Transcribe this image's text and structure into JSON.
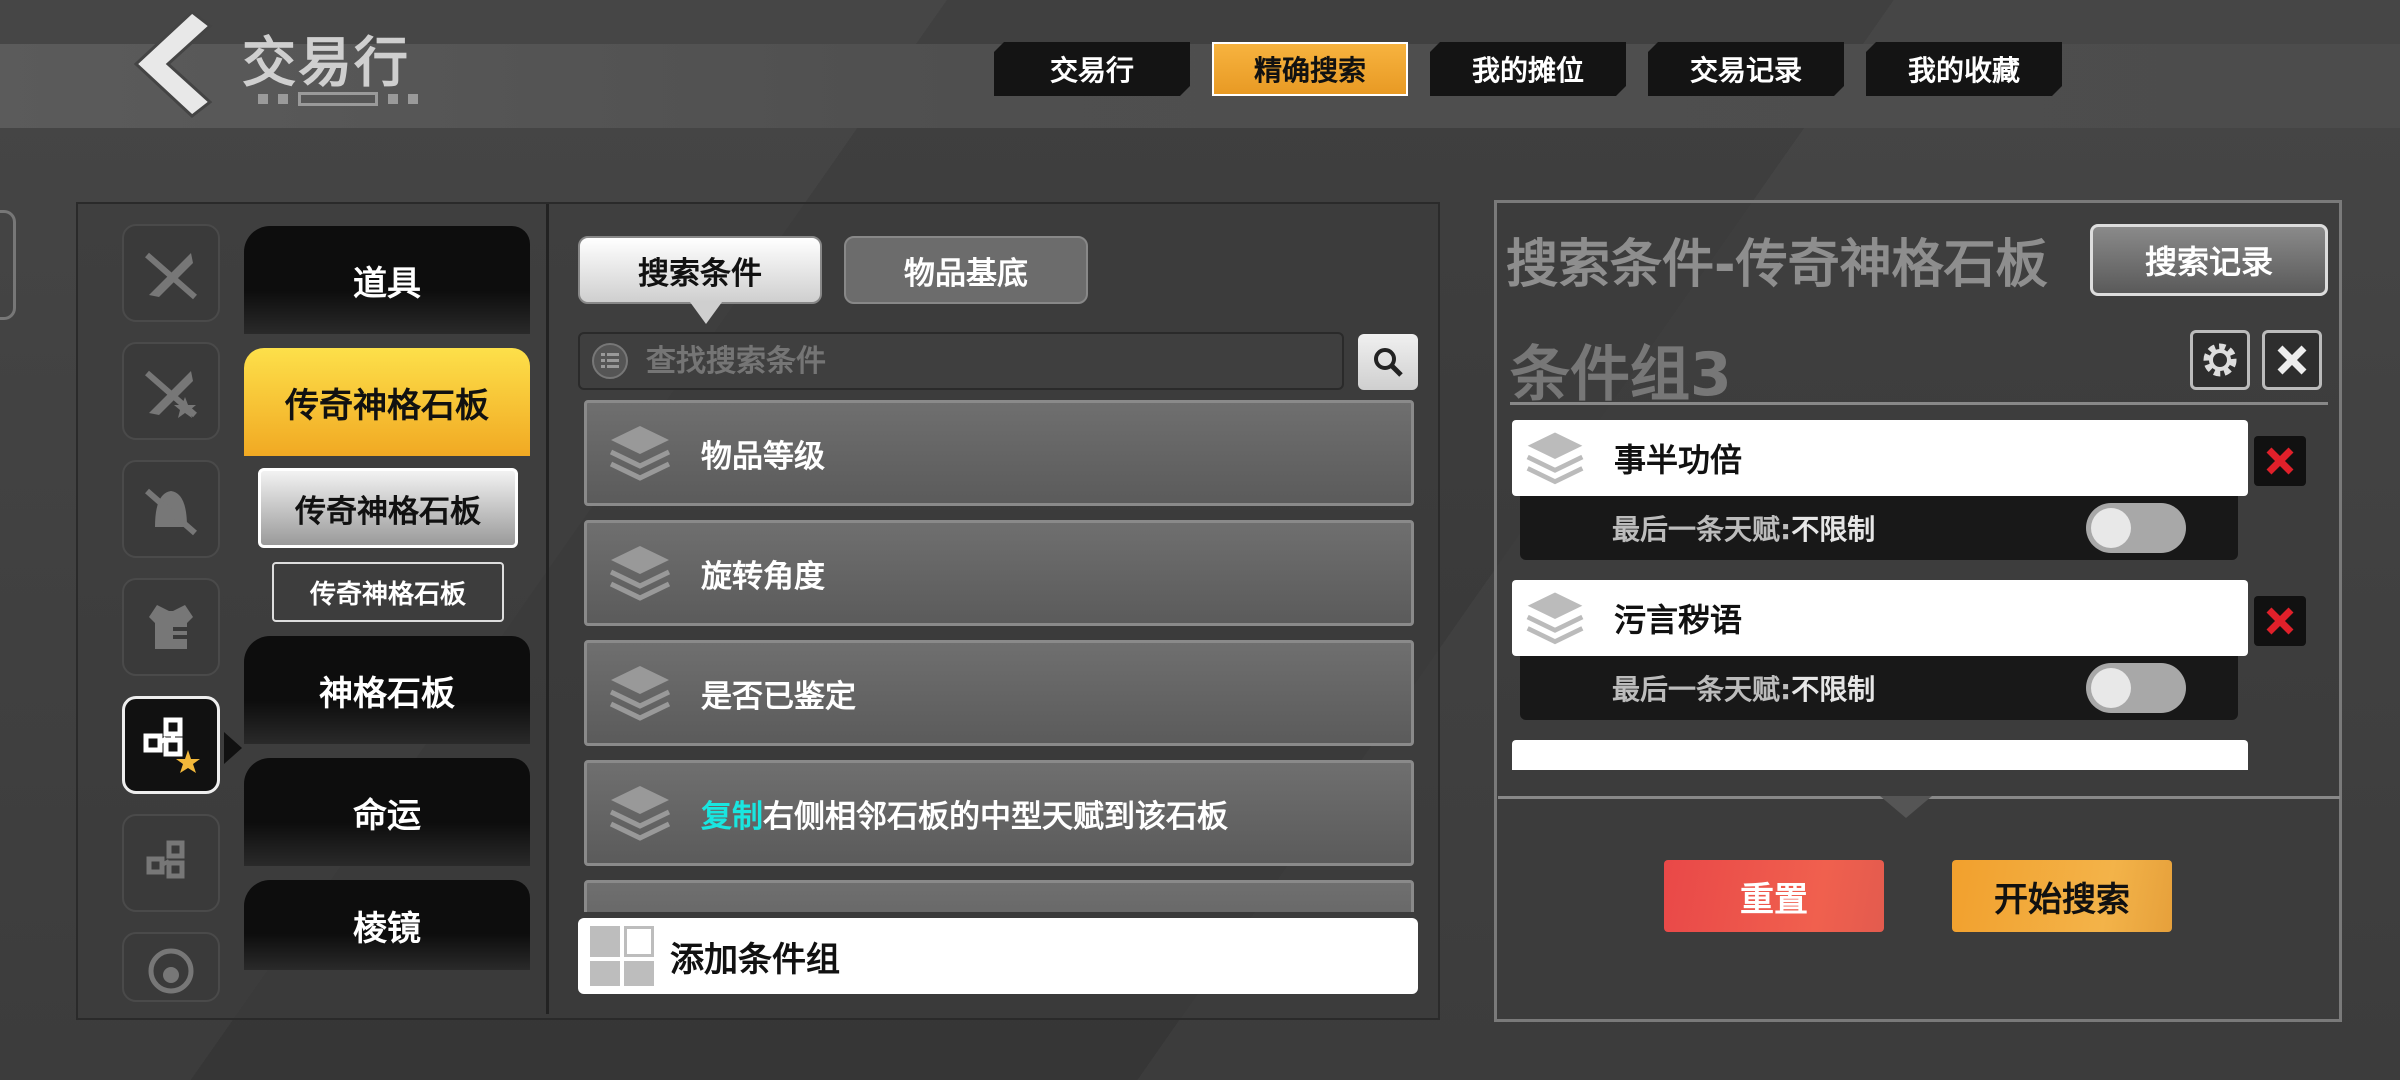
{
  "header": {
    "title": "交易行",
    "tabs": [
      {
        "label": "交易行",
        "active": false
      },
      {
        "label": "精确搜索",
        "active": true
      },
      {
        "label": "我的摊位",
        "active": false
      },
      {
        "label": "交易记录",
        "active": false
      },
      {
        "label": "我的收藏",
        "active": false
      }
    ]
  },
  "sidebar": {
    "category_icons": [
      "sword-slash-icon",
      "sword-star-icon",
      "helmet-icon",
      "armor-icon",
      "tile-star-icon",
      "tile-icon",
      "head-icon"
    ],
    "active_icon_index": 4,
    "categories": {
      "item_0": "道具",
      "item_1": "传奇神格石板",
      "sub_1": "传奇神格石板",
      "sub_2": "传奇神格石板",
      "item_2": "神格石板",
      "item_3": "命运",
      "item_4": "棱镜"
    }
  },
  "middle": {
    "tabs": {
      "conditions": "搜索条件",
      "base": "物品基底"
    },
    "search": {
      "placeholder": "查找搜索条件"
    },
    "conditions": {
      "c0": "物品等级",
      "c1": "旋转角度",
      "c2": "是否已鉴定",
      "c3_highlight": "复制",
      "c3_rest": "右侧相邻石板的中型天赋到该石板"
    },
    "add_group": "添加条件组"
  },
  "right": {
    "title": "搜索条件-传奇神格石板",
    "history_button": "搜索记录",
    "group_title": "条件组3",
    "rules": {
      "r0": {
        "name": "事半功倍",
        "sub_label": "最后一条天赋:",
        "sub_value": "不限制",
        "toggle_on": false
      },
      "r1": {
        "name": "污言秽语",
        "sub_label": "最后一条天赋:",
        "sub_value": "不限制",
        "toggle_on": false
      }
    },
    "reset_button": "重置",
    "start_button": "开始搜索"
  },
  "colors": {
    "accent_orange": "#f0a52a",
    "accent_yellow": "#f8d33e",
    "reset_red": "#eb4d4a",
    "delete_red": "#e0202a",
    "highlight_cyan": "#19e6e0"
  }
}
